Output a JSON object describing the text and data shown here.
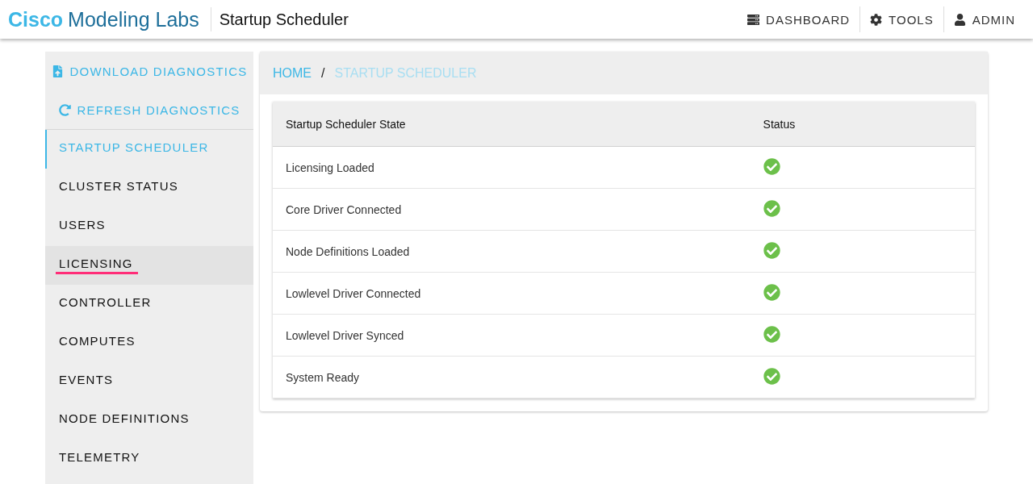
{
  "app_bar": {
    "brand_bold": "Cisco",
    "brand_rest": "Modeling Labs",
    "page_title": "Startup Scheduler",
    "menu": [
      {
        "kind": "dashboard",
        "label": "DASHBOARD"
      },
      {
        "kind": "tools",
        "label": "TOOLS"
      },
      {
        "kind": "user",
        "label": "ADMIN"
      }
    ]
  },
  "sidebar": {
    "actions": [
      {
        "kind": "download",
        "label": "DOWNLOAD DIAGNOSTICS"
      },
      {
        "kind": "refresh",
        "label": "REFRESH DIAGNOSTICS"
      }
    ],
    "items": [
      {
        "label": "STARTUP SCHEDULER",
        "selected": true,
        "hovered": false
      },
      {
        "label": "CLUSTER STATUS",
        "selected": false,
        "hovered": false
      },
      {
        "label": "USERS",
        "selected": false,
        "hovered": false
      },
      {
        "label": "LICENSING",
        "selected": false,
        "hovered": true
      },
      {
        "label": "CONTROLLER",
        "selected": false,
        "hovered": false
      },
      {
        "label": "COMPUTES",
        "selected": false,
        "hovered": false
      },
      {
        "label": "EVENTS",
        "selected": false,
        "hovered": false
      },
      {
        "label": "NODE DEFINITIONS",
        "selected": false,
        "hovered": false
      },
      {
        "label": "TELEMETRY",
        "selected": false,
        "hovered": false
      }
    ]
  },
  "breadcrumb": {
    "home": "HOME",
    "separator": "/",
    "current": "STARTUP SCHEDULER"
  },
  "table": {
    "columns": [
      "Startup Scheduler State",
      "Status"
    ],
    "rows": [
      {
        "state": "Licensing Loaded",
        "ok": true
      },
      {
        "state": "Core Driver Connected",
        "ok": true
      },
      {
        "state": "Node Definitions Loaded",
        "ok": true
      },
      {
        "state": "Lowlevel Driver Connected",
        "ok": true
      },
      {
        "state": "Lowlevel Driver Synced",
        "ok": true
      },
      {
        "state": "System Ready",
        "ok": true
      }
    ]
  }
}
